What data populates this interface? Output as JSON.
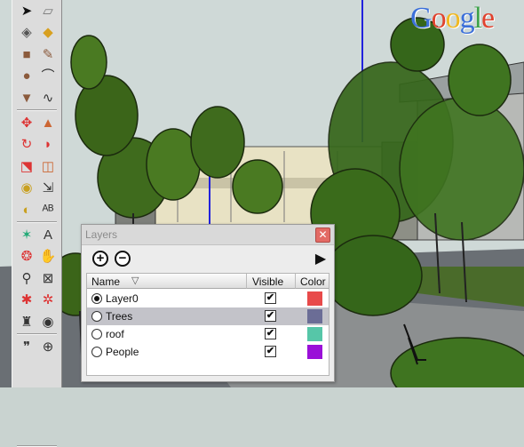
{
  "watermark": {
    "logo_text": "Google",
    "letters": [
      "G",
      "o",
      "o",
      "g",
      "l",
      "e"
    ],
    "colors": [
      "#3b6fd9",
      "#e0432f",
      "#f1b820",
      "#3b6fd9",
      "#3fa24b",
      "#e0432f"
    ]
  },
  "toolbar": {
    "tools": [
      {
        "name": "select-tool",
        "icon": "arrow-icon",
        "glyph": "➤",
        "color": "#111"
      },
      {
        "name": "eraser-tool",
        "icon": "eraser-icon",
        "glyph": "▱",
        "color": "#777"
      },
      {
        "name": "make-component-tool",
        "icon": "component-icon",
        "glyph": "◈",
        "color": "#555"
      },
      {
        "name": "paint-bucket-tool",
        "icon": "paint-bucket-icon",
        "glyph": "◆",
        "color": "#d8a020"
      },
      {
        "name": "rectangle-tool",
        "icon": "rectangle-icon",
        "glyph": "■",
        "color": "#8b5a3c"
      },
      {
        "name": "line-tool",
        "icon": "pencil-icon",
        "glyph": "✎",
        "color": "#8b5a3c"
      },
      {
        "name": "circle-tool",
        "icon": "circle-icon",
        "glyph": "●",
        "color": "#8b5a3c"
      },
      {
        "name": "arc-tool",
        "icon": "arc-icon",
        "glyph": "⌒",
        "color": "#333"
      },
      {
        "name": "polygon-tool",
        "icon": "polygon-icon",
        "glyph": "▼",
        "color": "#8b5a3c"
      },
      {
        "name": "freehand-tool",
        "icon": "freehand-icon",
        "glyph": "∿",
        "color": "#333"
      },
      {
        "name": "move-tool",
        "icon": "move-icon",
        "glyph": "✥",
        "color": "#d33"
      },
      {
        "name": "push-pull-tool",
        "icon": "push-pull-icon",
        "glyph": "▲",
        "color": "#c63"
      },
      {
        "name": "rotate-tool",
        "icon": "rotate-icon",
        "glyph": "↻",
        "color": "#d33"
      },
      {
        "name": "follow-me-tool",
        "icon": "follow-me-icon",
        "glyph": "◗",
        "color": "#d33"
      },
      {
        "name": "scale-tool",
        "icon": "scale-icon",
        "glyph": "⬔",
        "color": "#d33"
      },
      {
        "name": "offset-tool",
        "icon": "offset-icon",
        "glyph": "◫",
        "color": "#c63"
      },
      {
        "name": "tape-measure-tool",
        "icon": "tape-measure-icon",
        "glyph": "◉",
        "color": "#c9a020"
      },
      {
        "name": "dimension-tool",
        "icon": "dimension-icon",
        "glyph": "⇲",
        "color": "#333"
      },
      {
        "name": "protractor-tool",
        "icon": "protractor-icon",
        "glyph": "◐",
        "color": "#c9a020"
      },
      {
        "name": "text-tool",
        "icon": "text-icon",
        "glyph": "ᴬᴮ",
        "color": "#333"
      },
      {
        "name": "axes-tool",
        "icon": "axes-icon",
        "glyph": "✶",
        "color": "#2a7"
      },
      {
        "name": "3d-text-tool",
        "icon": "3d-text-icon",
        "glyph": "A",
        "color": "#333"
      },
      {
        "name": "orbit-tool",
        "icon": "orbit-icon",
        "glyph": "❂",
        "color": "#d33"
      },
      {
        "name": "pan-tool",
        "icon": "hand-icon",
        "glyph": "✋",
        "color": "#555"
      },
      {
        "name": "zoom-tool",
        "icon": "magnifier-icon",
        "glyph": "⚲",
        "color": "#333"
      },
      {
        "name": "zoom-window-tool",
        "icon": "zoom-window-icon",
        "glyph": "⊠",
        "color": "#333"
      },
      {
        "name": "zoom-previous-tool",
        "icon": "zoom-previous-icon",
        "glyph": "✱",
        "color": "#d33"
      },
      {
        "name": "zoom-extents-tool",
        "icon": "zoom-extents-icon",
        "glyph": "✲",
        "color": "#d33"
      },
      {
        "name": "position-camera-tool",
        "icon": "camera-position-icon",
        "glyph": "♜",
        "color": "#333"
      },
      {
        "name": "look-around-tool",
        "icon": "eye-icon",
        "glyph": "◉",
        "color": "#333"
      },
      {
        "name": "walk-tool",
        "icon": "footprints-icon",
        "glyph": "❞",
        "color": "#333"
      },
      {
        "name": "section-plane-tool",
        "icon": "section-plane-icon",
        "glyph": "⊕",
        "color": "#333"
      }
    ]
  },
  "layers_panel": {
    "title": "Layers",
    "close_glyph": "✕",
    "add_glyph": "+",
    "delete_glyph": "−",
    "details_glyph": "▶",
    "columns": {
      "name": "Name",
      "visible": "Visible",
      "color": "Color",
      "sort_glyph": "▽"
    },
    "layers": [
      {
        "name": "Layer0",
        "active": true,
        "visible": true,
        "selected": false,
        "color": "#e84a4a"
      },
      {
        "name": "Trees",
        "active": false,
        "visible": true,
        "selected": true,
        "color": "#6b6d96"
      },
      {
        "name": "roof",
        "active": false,
        "visible": true,
        "selected": false,
        "color": "#56c6a8"
      },
      {
        "name": "People",
        "active": false,
        "visible": true,
        "selected": false,
        "color": "#9a10d8"
      }
    ],
    "check_glyph": "✔"
  }
}
